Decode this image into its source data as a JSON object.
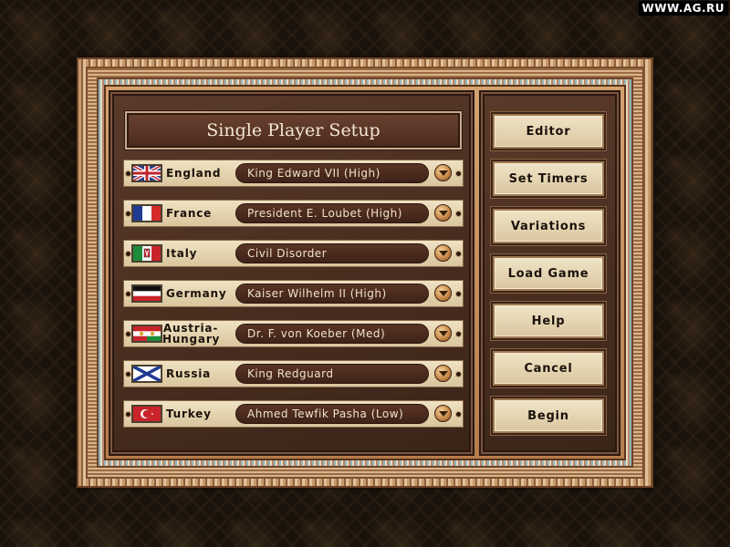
{
  "watermark": "WWW.AG.RU",
  "title": "Single Player Setup",
  "nations": [
    {
      "name": "England",
      "leader": "King Edward VII (High)",
      "flag": "union-jack-flag-icon"
    },
    {
      "name": "France",
      "leader": "President E. Loubet (High)",
      "flag": "french-tricolor-flag-icon"
    },
    {
      "name": "Italy",
      "leader": "Civil Disorder",
      "flag": "italian-flag-icon"
    },
    {
      "name": "Germany",
      "leader": "Kaiser Wilhelm II (High)",
      "flag": "german-empire-flag-icon"
    },
    {
      "name_line1": "Austria-",
      "name_line2": "Hungary",
      "leader": "Dr. F. von Koeber (Med)",
      "flag": "austria-hungary-flag-icon"
    },
    {
      "name": "Russia",
      "leader": "King Redguard",
      "flag": "st-andrew-cross-flag-icon"
    },
    {
      "name": "Turkey",
      "leader": "Ahmed Tewfik Pasha (Low)",
      "flag": "ottoman-crescent-flag-icon"
    }
  ],
  "menu": {
    "editor": "Editor",
    "set_timers": "Set Timers",
    "variations": "Variations",
    "load_game": "Load Game",
    "help": "Help",
    "cancel": "Cancel",
    "begin": "Begin"
  },
  "colors": {
    "panel": "#4a2e20",
    "plate": "#e8dabb",
    "frame": "#c49a6e"
  }
}
